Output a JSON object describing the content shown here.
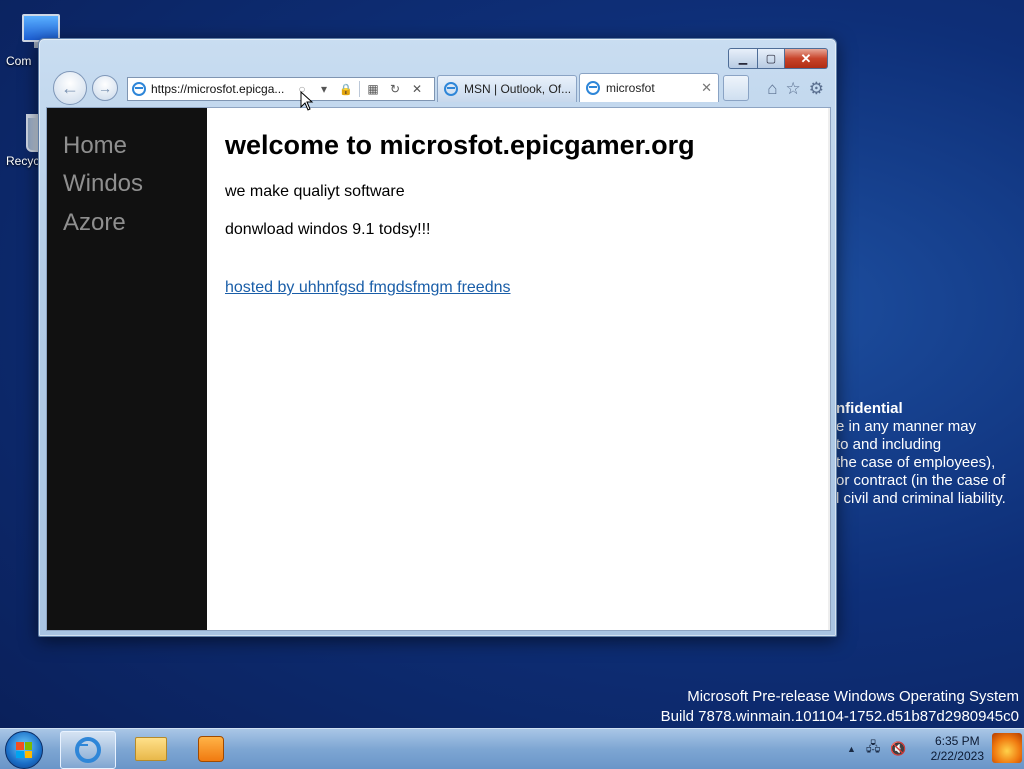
{
  "desktop": {
    "icons": [
      {
        "label": "Com"
      },
      {
        "label": "Recyc"
      }
    ],
    "confidential": {
      "title": "nfidential",
      "lines": [
        "e in any manner may",
        " to and including",
        " the case of employees),",
        "or contract (in the case of",
        "l civil and criminal liability."
      ]
    },
    "build": {
      "line1": "Microsoft Pre-release Windows Operating System",
      "line2": "Build 7878.winmain.101104-1752.d51b87d2980945c0"
    }
  },
  "browser": {
    "window_buttons": {
      "minimize": "▁",
      "maximize": "▢",
      "close": "✕"
    },
    "address": {
      "url": "https://microsfot.epicga...",
      "search_icon": "search-icon",
      "dropdown": "▾",
      "lock": "🔒",
      "compat": "▦",
      "refresh": "↻",
      "stop": "✕"
    },
    "tabs": [
      {
        "label": "MSN | Outlook, Of...",
        "active": false
      },
      {
        "label": "microsfot",
        "active": true,
        "close": "✕"
      }
    ],
    "tools": {
      "home": "⌂",
      "favorites": "☆",
      "settings": "⚙"
    }
  },
  "page": {
    "sidebar": [
      "Home",
      "Windos",
      "Azore"
    ],
    "heading": "welcome to microsfot.epicgamer.org",
    "para1": "we make qualiyt software",
    "para2": "donwload windos 9.1 todsy!!!",
    "link": "hosted by uhhnfgsd fmgdsfmgm freedns"
  },
  "taskbar": {
    "clock_time": "6:35 PM",
    "clock_date": "2/22/2023",
    "tray": {
      "arrow": "▲",
      "network": "🖧",
      "volume_muted": "🔇"
    }
  },
  "colors": {
    "link": "#1a5ea8",
    "sidebar": "#111111",
    "accent": "#2e86d8"
  }
}
